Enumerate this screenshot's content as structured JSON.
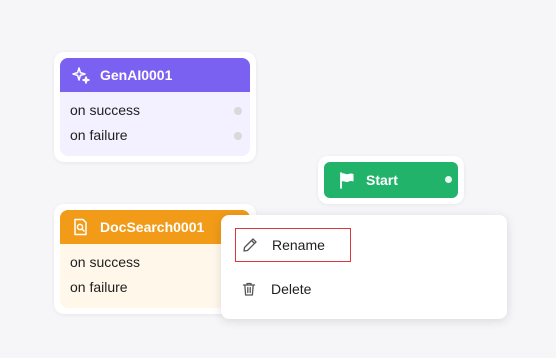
{
  "nodes": {
    "genai": {
      "title": "GenAI0001",
      "icon": "sparkles-icon",
      "ports": [
        "on success",
        "on failure"
      ],
      "header_color": "#7b61f2"
    },
    "docsearch": {
      "title": "DocSearch0001",
      "icon": "doc-search-icon",
      "ports": [
        "on success",
        "on failure"
      ],
      "header_color": "#f29b18"
    },
    "start": {
      "title": "Start",
      "icon": "flag-icon",
      "color": "#22b36a"
    }
  },
  "context_menu": {
    "items": [
      {
        "label": "Rename",
        "icon": "pencil-icon"
      },
      {
        "label": "Delete",
        "icon": "trash-icon"
      }
    ],
    "highlight_color": "#d9363e"
  }
}
